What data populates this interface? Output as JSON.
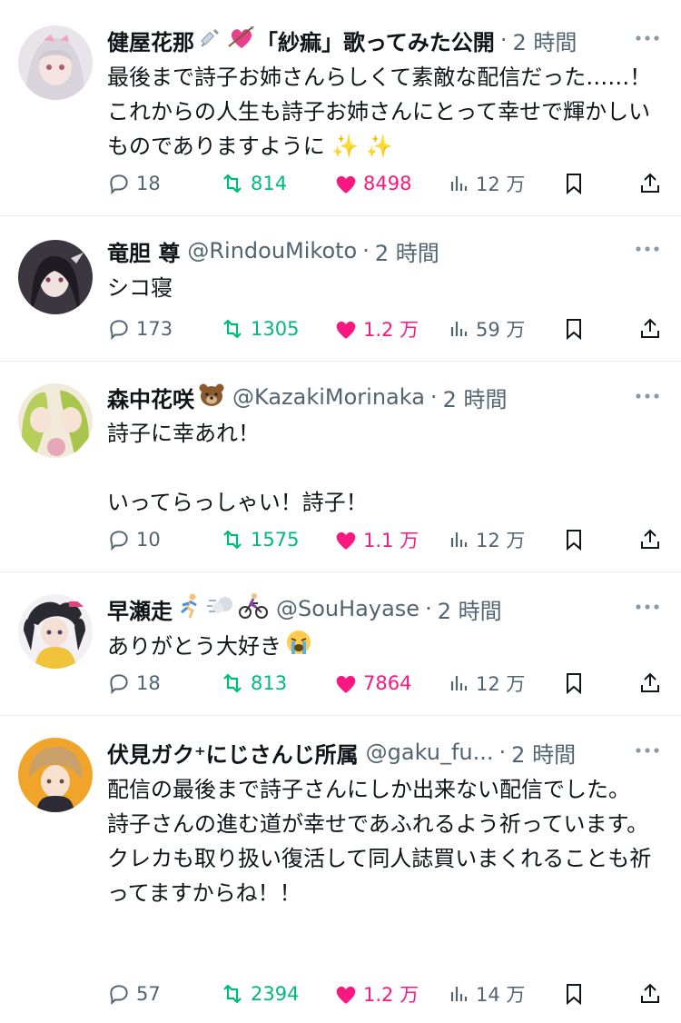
{
  "colors": {
    "accent_like": "#f91880",
    "accent_retweet": "#00ba7c",
    "muted": "#536471"
  },
  "tweets": [
    {
      "name": "健屋花那",
      "name_suffix": "「紗痲」歌ってみた公開",
      "handle": "",
      "time": "2 時間",
      "text": "最後まで詩子お姉さんらしくて素敵な配信だった……！これからの人生も詩子お姉さんにとって幸せで輝かしいものでありますように",
      "replies": "18",
      "retweets": "814",
      "likes": "8498",
      "views": "12 万",
      "emoji_after_name": [
        "syringe",
        "heart-with-arrow"
      ],
      "emoji_after_text": [
        "sparkles",
        "sparkles"
      ]
    },
    {
      "name": "竜胆 尊",
      "handle": "@RindouMikoto",
      "time": "2 時間",
      "text": "シコ寝",
      "replies": "173",
      "retweets": "1305",
      "likes": "1.2 万",
      "views": "59 万"
    },
    {
      "name": "森中花咲",
      "handle": "@KazakiMorinaka",
      "time": "2 時間",
      "text": "詩子に幸あれ！\n\nいってらっしゃい！詩子！",
      "replies": "10",
      "retweets": "1575",
      "likes": "1.1 万",
      "views": "12 万",
      "emoji_after_name": [
        "bear"
      ]
    },
    {
      "name": "早瀬走",
      "handle": "@SouHayase",
      "time": "2 時間",
      "text": "ありがとう大好き",
      "replies": "18",
      "retweets": "813",
      "likes": "7864",
      "views": "12 万",
      "emoji_after_name": [
        "runner",
        "dash",
        "cyclist"
      ],
      "emoji_after_text": [
        "crying-face"
      ]
    },
    {
      "name": "伏見ガク⁺にじさんじ所属",
      "handle": "@gaku_fu...",
      "time": "2 時間",
      "text": "配信の最後まで詩子さんにしか出来ない配信でした。\n詩子さんの進む道が幸せであふれるよう祈っています。\nクレカも取り扱い復活して同人誌買いまくれることも祈ってますからね！！",
      "replies": "57",
      "retweets": "2394",
      "likes": "1.2 万",
      "views": "14 万"
    }
  ]
}
